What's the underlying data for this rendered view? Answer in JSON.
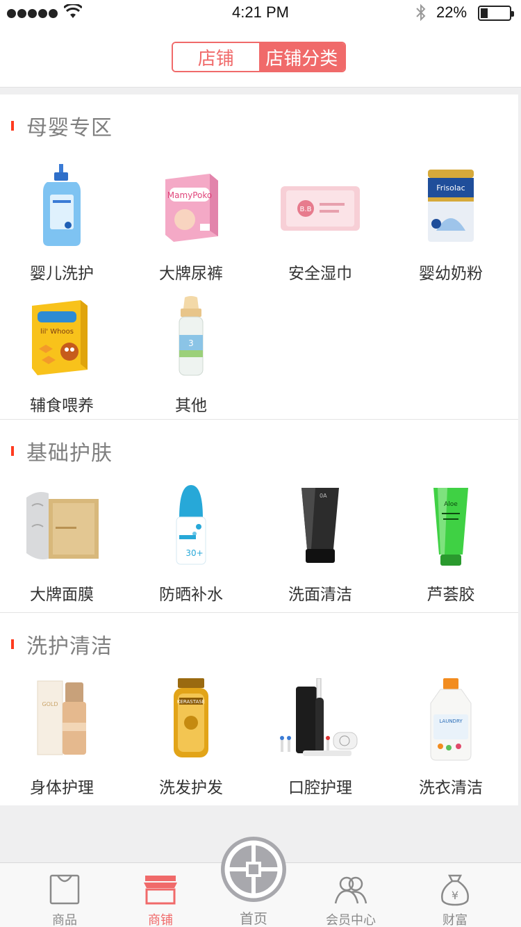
{
  "status": {
    "time": "4:21 PM",
    "battery": "22%"
  },
  "header": {
    "tabs": [
      {
        "label": "店铺"
      },
      {
        "label": "店铺分类"
      }
    ]
  },
  "sections": [
    {
      "title": "母婴专区",
      "items": [
        {
          "label": "婴儿洗护",
          "icon": "baby-wash-bottle"
        },
        {
          "label": "大牌尿裤",
          "icon": "diaper-pack"
        },
        {
          "label": "安全湿巾",
          "icon": "wet-wipes"
        },
        {
          "label": "婴幼奶粉",
          "icon": "milk-powder-can"
        },
        {
          "label": "辅食喂养",
          "icon": "baby-food-box"
        },
        {
          "label": "其他",
          "icon": "baby-bottle"
        }
      ]
    },
    {
      "title": "基础护肤",
      "items": [
        {
          "label": "大牌面膜",
          "icon": "face-mask"
        },
        {
          "label": "防晒补水",
          "icon": "sunscreen-bottle"
        },
        {
          "label": "洗面清洁",
          "icon": "cleanser-tube"
        },
        {
          "label": "芦荟胶",
          "icon": "aloe-gel-tube"
        }
      ]
    },
    {
      "title": "洗护清洁",
      "items": [
        {
          "label": "身体护理",
          "icon": "body-care-bottle"
        },
        {
          "label": "洗发护发",
          "icon": "shampoo-bottle"
        },
        {
          "label": "口腔护理",
          "icon": "electric-toothbrush"
        },
        {
          "label": "洗衣清洁",
          "icon": "laundry-detergent"
        }
      ]
    }
  ],
  "tabbar": {
    "items": [
      {
        "label": "商品",
        "icon": "shopping-bag-icon"
      },
      {
        "label": "商铺",
        "icon": "storefront-icon"
      },
      {
        "label": "首页",
        "icon": "home-coin-icon"
      },
      {
        "label": "会员中心",
        "icon": "members-icon"
      },
      {
        "label": "财富",
        "icon": "money-bag-icon"
      }
    ],
    "active": "商铺"
  },
  "colors": {
    "accent": "#f06a6a",
    "section_marker": "#ff3b1f"
  }
}
